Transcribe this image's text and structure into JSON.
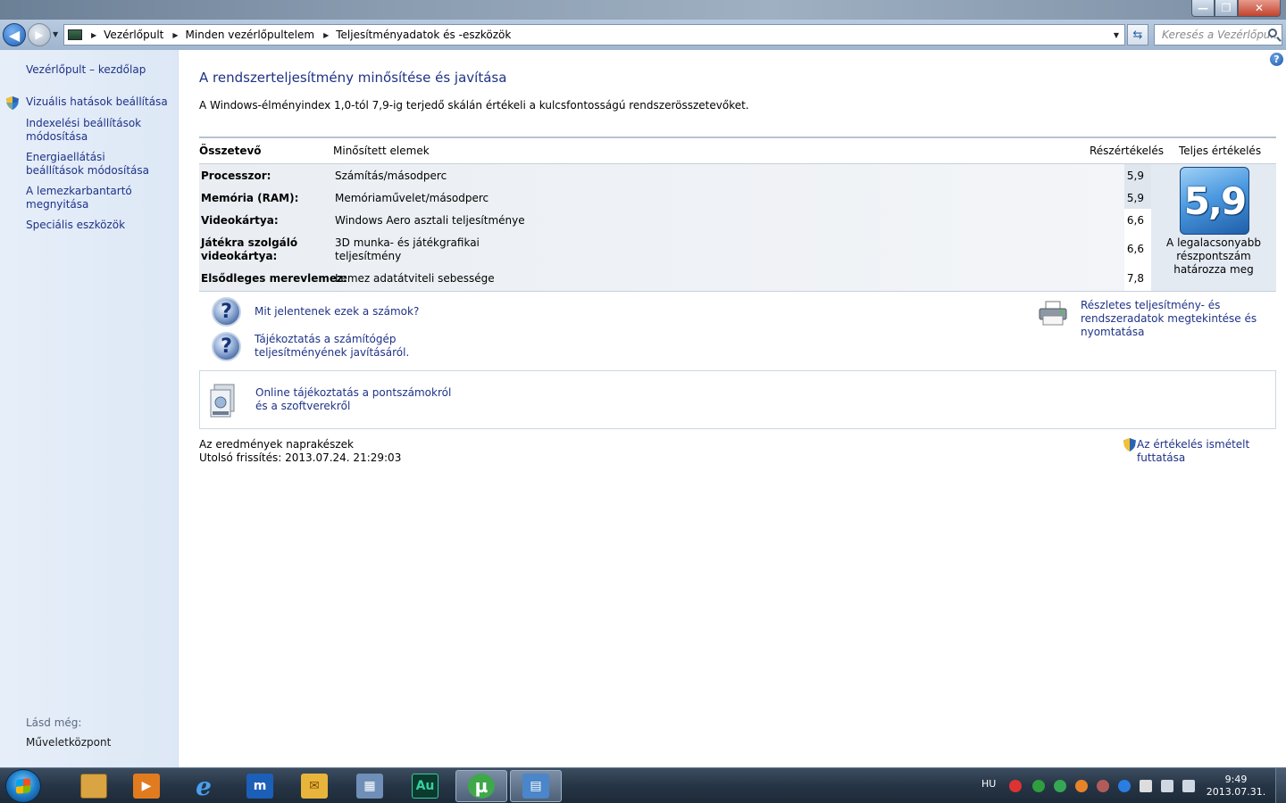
{
  "window": {
    "minimize_glyph": "—",
    "maximize_glyph": "❐",
    "close_glyph": "✕"
  },
  "navbar": {
    "breadcrumbs": [
      "Vezérlőpult",
      "Minden vezérlőpultelem",
      "Teljesítményadatok és -eszközök"
    ],
    "search_placeholder": "Keresés a Vezérlőpu..."
  },
  "sidebar": {
    "home": "Vezérlőpult – kezdőlap",
    "items": [
      {
        "label": "Vizuális hatások beállítása",
        "icon": "shield-icon"
      },
      {
        "label": "Indexelési beállítások módosítása"
      },
      {
        "label": "Energiaellátási beállítások módosítása"
      },
      {
        "label": "A lemezkarbantartó megnyitása"
      },
      {
        "label": "Speciális eszközök"
      }
    ],
    "see_also_label": "Lásd még:",
    "see_also_link": "Műveletközpont"
  },
  "main": {
    "title": "A rendszerteljesítmény minősítése és javítása",
    "description": "A Windows-élményindex 1,0-tól 7,9-ig terjedő skálán értékeli a kulcsfontosságú rendszerösszetevőket.",
    "table": {
      "headers": {
        "component": "Összetevő",
        "rated": "Minősített elemek",
        "subscore": "Részértékelés",
        "base": "Teljes értékelés"
      },
      "rows": [
        {
          "component": "Processzor:",
          "rated": "Számítás/másodperc",
          "subscore": "5,9"
        },
        {
          "component": "Memória (RAM):",
          "rated": "Memóriaművelet/másodperc",
          "subscore": "5,9"
        },
        {
          "component": "Videokártya:",
          "rated": "Windows Aero asztali teljesítménye",
          "subscore": "6,6"
        },
        {
          "component": "Játékra szolgáló videokártya:",
          "rated": "3D munka- és játékgrafikai teljesítmény",
          "subscore": "6,6"
        },
        {
          "component": "Elsődleges merevlemez:",
          "rated": "Lemez adatátviteli sebessége",
          "subscore": "7,8"
        }
      ],
      "base_score": "5,9",
      "base_caption": "A legalacsonyabb részpontszám határozza meg"
    },
    "links": {
      "what_numbers_mean": "Mit jelentenek ezek a számok?",
      "tips_improve": "Tájékoztatás a számítógép teljesítményének javításáról.",
      "details_print": "Részletes teljesítmény- és rendszeradatok megtekintése és nyomtatása",
      "online_info": "Online tájékoztatás a pontszámokról és a szoftverekről",
      "rerun": "Az értékelés ismételt futtatása"
    },
    "status": {
      "current": "Az eredmények naprakészek",
      "last_update": "Utolsó frissítés: 2013.07.24. 21:29:03"
    }
  },
  "taskbar": {
    "apps": [
      {
        "name": "explorer",
        "glyph": "",
        "color": "#d9a441"
      },
      {
        "name": "media-player",
        "glyph": "▶",
        "color": "#e07b1f"
      },
      {
        "name": "internet-explorer",
        "glyph": "e",
        "color": "#2f7fd6"
      },
      {
        "name": "maxthon",
        "glyph": "m",
        "color": "#1b5fb8"
      },
      {
        "name": "mail",
        "glyph": "✉",
        "color": "#e8b43c"
      },
      {
        "name": "calculator",
        "glyph": "▦",
        "color": "#6f8fb8"
      },
      {
        "name": "audition",
        "glyph": "Au",
        "color": "#0b3a2e"
      },
      {
        "name": "utorrent",
        "glyph": "µ",
        "color": "#3ea84a"
      },
      {
        "name": "control-panel",
        "glyph": "▤",
        "color": "#4a86c9"
      }
    ],
    "language": "HU",
    "time": "9:49",
    "date": "2013.07.31."
  }
}
